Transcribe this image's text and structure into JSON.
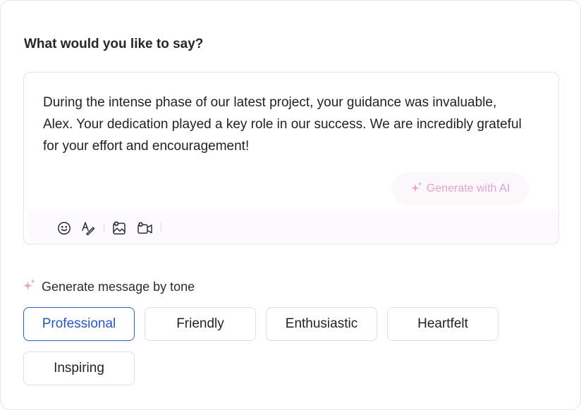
{
  "heading": "What would you like to say?",
  "message_text": "During the intense phase of our latest project, your guidance was invaluable, Alex. Your dedication played a key role in our success. We are incredibly grateful for your effort and encouragement!",
  "generate_ai_label": "Generate with AI",
  "toolbar": {
    "icons": [
      "emoji-icon",
      "text-format-icon",
      "add-image-icon",
      "add-video-icon"
    ]
  },
  "tone_section": {
    "title": "Generate message by tone",
    "selected": "Professional",
    "options": [
      "Professional",
      "Friendly",
      "Enthusiastic",
      "Heartfelt",
      "Inspiring"
    ]
  },
  "colors": {
    "accent": "#2b62c8",
    "ai_gradient_start": "#f0a3b6",
    "ai_gradient_end": "#d5a0e2",
    "sparkle": "#e7a2b8"
  }
}
